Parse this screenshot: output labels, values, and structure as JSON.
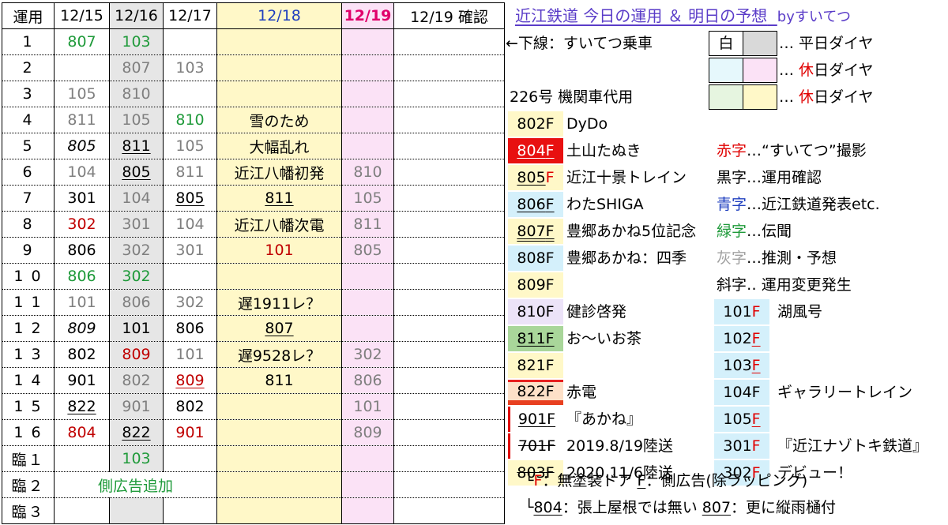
{
  "schedule": {
    "headers": [
      "運用",
      "12/15",
      "12/16",
      "12/17",
      "12/18",
      "12/19",
      "12/19 確認"
    ],
    "rows": [
      {
        "unyo": "1",
        "d15": {
          "t": "807",
          "c": "green"
        },
        "d16": {
          "t": "103",
          "c": "green"
        },
        "d17": {
          "t": ""
        },
        "d18": {
          "t": ""
        },
        "d19": {
          "t": ""
        }
      },
      {
        "unyo": "2",
        "d15": {
          "t": ""
        },
        "d16": {
          "t": "807",
          "c": "gray"
        },
        "d17": {
          "t": "103",
          "c": "gray"
        },
        "d18": {
          "t": ""
        },
        "d19": {
          "t": ""
        }
      },
      {
        "unyo": "3",
        "d15": {
          "t": "105",
          "c": "gray"
        },
        "d16": {
          "t": "810",
          "c": "gray"
        },
        "d17": {
          "t": ""
        },
        "d18": {
          "t": ""
        },
        "d19": {
          "t": ""
        }
      },
      {
        "unyo": "4",
        "d15": {
          "t": "811",
          "c": "gray"
        },
        "d16": {
          "t": "105",
          "c": "gray"
        },
        "d17": {
          "t": "810",
          "c": "green"
        },
        "d18": {
          "t": "雪のため",
          "c": "black"
        },
        "d19": {
          "t": ""
        }
      },
      {
        "unyo": "5",
        "d15": {
          "t": "805",
          "c": "black",
          "it": true
        },
        "d16": {
          "t": "811",
          "c": "black",
          "ul": true
        },
        "d17": {
          "t": "105",
          "c": "gray"
        },
        "d18": {
          "t": "大幅乱れ",
          "c": "black"
        },
        "d19": {
          "t": ""
        }
      },
      {
        "unyo": "6",
        "d15": {
          "t": "104",
          "c": "gray"
        },
        "d16": {
          "t": "805",
          "c": "black",
          "ul": true
        },
        "d17": {
          "t": "811",
          "c": "gray"
        },
        "d18": {
          "t": "近江八幡初発",
          "c": "black"
        },
        "d19": {
          "t": "810",
          "c": "gray"
        }
      },
      {
        "unyo": "7",
        "d15": {
          "t": "301",
          "c": "black"
        },
        "d16": {
          "t": "104",
          "c": "gray"
        },
        "d17": {
          "t": "805",
          "c": "black",
          "ul": true
        },
        "d18": {
          "t": "811",
          "c": "black",
          "ul": true
        },
        "d19": {
          "t": "105",
          "c": "gray"
        }
      },
      {
        "unyo": "8",
        "d15": {
          "t": "302",
          "c": "red"
        },
        "d16": {
          "t": "301",
          "c": "gray"
        },
        "d17": {
          "t": "104",
          "c": "gray"
        },
        "d18": {
          "t": "近江八幡次電",
          "c": "black"
        },
        "d19": {
          "t": "811",
          "c": "gray"
        }
      },
      {
        "unyo": "9",
        "d15": {
          "t": "806",
          "c": "black"
        },
        "d16": {
          "t": "302",
          "c": "gray"
        },
        "d17": {
          "t": "301",
          "c": "gray"
        },
        "d18": {
          "t": "101",
          "c": "red"
        },
        "d19": {
          "t": "805",
          "c": "gray"
        }
      },
      {
        "unyo": "1 0",
        "d15": {
          "t": "806",
          "c": "green"
        },
        "d16": {
          "t": "302",
          "c": "green"
        },
        "d17": {
          "t": ""
        },
        "d18": {
          "t": ""
        },
        "d19": {
          "t": ""
        }
      },
      {
        "unyo": "1 1",
        "d15": {
          "t": "101",
          "c": "gray"
        },
        "d16": {
          "t": "806",
          "c": "gray"
        },
        "d17": {
          "t": "302",
          "c": "gray"
        },
        "d18": {
          "t": "遅1911レ？",
          "c": "black"
        },
        "d19": {
          "t": ""
        }
      },
      {
        "unyo": "1 2",
        "d15": {
          "t": "809",
          "c": "black",
          "it": true
        },
        "d16": {
          "t": "101",
          "c": "black"
        },
        "d17": {
          "t": "806",
          "c": "black"
        },
        "d18": {
          "t": "807",
          "c": "black",
          "ul": true
        },
        "d19": {
          "t": ""
        }
      },
      {
        "unyo": "1 3",
        "d15": {
          "t": "802",
          "c": "black"
        },
        "d16": {
          "t": "809",
          "c": "red"
        },
        "d17": {
          "t": "101",
          "c": "gray"
        },
        "d18": {
          "t": "遅9528レ？",
          "c": "black"
        },
        "d19": {
          "t": "302",
          "c": "gray"
        }
      },
      {
        "unyo": "1 4",
        "d15": {
          "t": "901",
          "c": "black"
        },
        "d16": {
          "t": "802",
          "c": "gray"
        },
        "d17": {
          "t": "809",
          "c": "red",
          "ul": true
        },
        "d18": {
          "t": "811",
          "c": "black"
        },
        "d19": {
          "t": "806",
          "c": "gray"
        }
      },
      {
        "unyo": "1 5",
        "d15": {
          "t": "822",
          "c": "black",
          "ul": true
        },
        "d16": {
          "t": "901",
          "c": "gray"
        },
        "d17": {
          "t": "802",
          "c": "black"
        },
        "d18": {
          "t": ""
        },
        "d19": {
          "t": "101",
          "c": "gray"
        }
      },
      {
        "unyo": "1 6",
        "d15": {
          "t": "804",
          "c": "red"
        },
        "d16": {
          "t": "822",
          "c": "black",
          "ul": true
        },
        "d17": {
          "t": "901",
          "c": "red"
        },
        "d18": {
          "t": ""
        },
        "d19": {
          "t": "809",
          "c": "gray"
        }
      },
      {
        "unyo": "臨１",
        "d15": {
          "t": ""
        },
        "d16": {
          "t": "103",
          "c": "green"
        },
        "d17": {
          "t": ""
        },
        "d18": {
          "t": ""
        },
        "d19": {
          "t": ""
        }
      },
      {
        "unyo": "臨２",
        "span": "側広告追加",
        "spanColor": "green",
        "d18": {
          "t": ""
        },
        "d19": {
          "t": ""
        }
      },
      {
        "unyo": "臨３",
        "d15": {
          "t": ""
        },
        "d16": {
          "t": ""
        },
        "d17": {
          "t": ""
        },
        "d18": {
          "t": ""
        },
        "d19": {
          "t": ""
        }
      }
    ]
  },
  "legend": {
    "title": "近江鉄道 今日の運用 ＆ 明日の予想",
    "byline": "byすいてつ",
    "note_underline": "←下線：すいてつ乗車",
    "note_226": "226号 機関車代用",
    "swatch_white": "白",
    "dia_weekday_prefix": "… 平日ダイヤ",
    "dia_holiday_1_prefix": "… ",
    "dia_holiday_1_red": "休",
    "dia_holiday_1_rest": "日ダイヤ",
    "dia_holiday_2_prefix": "… ",
    "dia_holiday_2_red": "休",
    "dia_holiday_2_rest": "日ダイヤ",
    "colors_meaning": [
      {
        "label": "赤字",
        "color": "red",
        "text": "…“すいてつ”撮影"
      },
      {
        "label": "黒字",
        "color": "black",
        "text": "…運用確認"
      },
      {
        "label": "青字",
        "color": "blue",
        "text": "…近江鉄道発表etc."
      },
      {
        "label": "緑字",
        "color": "green",
        "text": "…伝聞"
      },
      {
        "label": "灰字",
        "color": "gray",
        "text": "…推測・予想"
      },
      {
        "label": "斜字",
        "color": "black",
        "text": "‥ 運用変更発生"
      }
    ],
    "cars_left": [
      {
        "num": "802",
        "f": "F",
        "name": "DyDo"
      },
      {
        "num": "804",
        "f": "F",
        "name": "土山たぬき"
      },
      {
        "num": "805",
        "f": "F",
        "name": "近江十景トレイン"
      },
      {
        "num": "806",
        "f": "F",
        "name": "わたSHIGA"
      },
      {
        "num": "807",
        "f": "F",
        "name": "豊郷あかね5位記念"
      },
      {
        "num": "808",
        "f": "F",
        "name": "豊郷あかね：四季"
      },
      {
        "num": "809",
        "f": "F",
        "name": ""
      },
      {
        "num": "810",
        "f": "F",
        "name": "健診啓発"
      },
      {
        "num": "811",
        "f": "F",
        "name": "お～いお茶"
      },
      {
        "num": "821",
        "f": "F",
        "name": ""
      },
      {
        "num": "822",
        "f": "F",
        "name": "赤電"
      },
      {
        "num": "901",
        "f": "F",
        "name": "『あかね』"
      },
      {
        "num": "701",
        "f": "F",
        "name": "2019.8/19陸送"
      },
      {
        "num": "803",
        "f": "F",
        "name": "2020.11/6陸送"
      }
    ],
    "cars_right": [
      {
        "num": "101",
        "f": "F",
        "name": "湖風号"
      },
      {
        "num": "102",
        "f": "F",
        "name": ""
      },
      {
        "num": "103",
        "f": "F",
        "name": ""
      },
      {
        "num": "104",
        "f": "F",
        "name": "ギャラリートレイン"
      },
      {
        "num": "105",
        "f": "F",
        "name": ""
      },
      {
        "num": "301",
        "f": "F",
        "name": "『近江ナゾトキ鉄道』"
      },
      {
        "num": "302",
        "f": "F",
        "name": "デビュー！"
      }
    ],
    "foot1_a": "└",
    "foot1_red": "F",
    "foot1_b": "：無塗装ドア ",
    "foot1_ul": "F",
    "foot1_c": "：側広告(除ラッピング)",
    "foot2_a": "└",
    "foot2_ul1": "804",
    "foot2_b": "：張上屋根では無い ",
    "foot2_ul2": "807",
    "foot2_c": "：更に縦雨樋付"
  },
  "colors": {
    "red": "#c00000",
    "green": "#1f9a3a",
    "gray": "#7f7f7f",
    "blue": "#1f3fbf",
    "title": "#5a3cc8",
    "header_red": "#e0006a"
  }
}
